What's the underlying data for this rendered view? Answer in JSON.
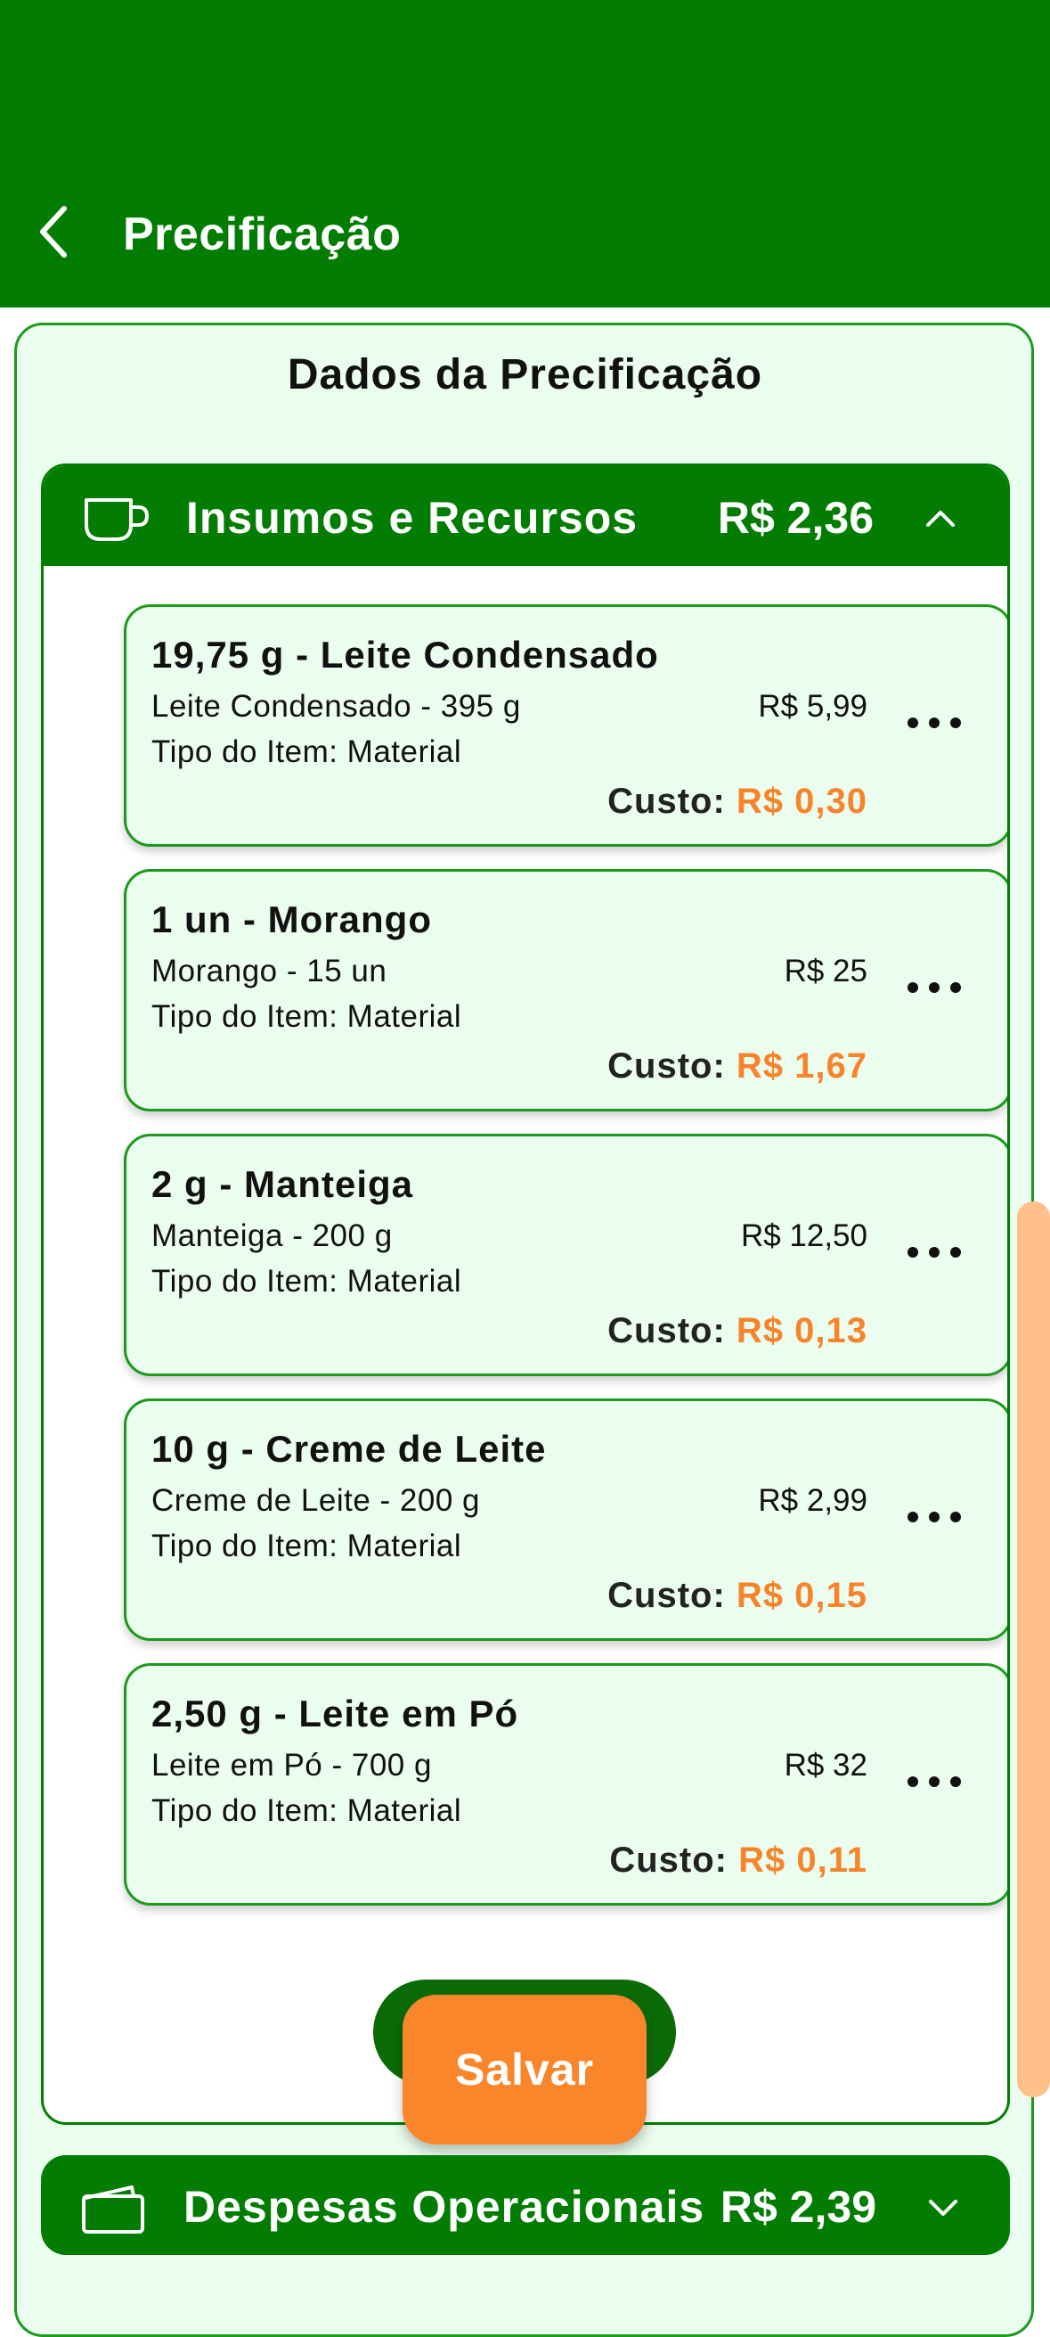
{
  "header": {
    "title": "Precificação",
    "background": "#027d02"
  },
  "panel": {
    "title": "Dados da Precificação"
  },
  "sections": [
    {
      "icon": "cup-icon",
      "title": "Insumos e Recursos",
      "total": "R$ 2,36",
      "expanded": true,
      "items": [
        {
          "title": "19,75 g - Leite Condensado",
          "description": "Leite Condensado - 395 g",
          "price": "R$ 5,99",
          "type": "Tipo do Item: Material",
          "cost_label": "Custo:",
          "cost_value": "R$ 0,30"
        },
        {
          "title": "1 un - Morango",
          "description": "Morango - 15 un",
          "price": "R$ 25",
          "type": "Tipo do Item: Material",
          "cost_label": "Custo:",
          "cost_value": "R$ 1,67"
        },
        {
          "title": "2 g - Manteiga",
          "description": "Manteiga - 200 g",
          "price": "R$ 12,50",
          "type": "Tipo do Item: Material",
          "cost_label": "Custo:",
          "cost_value": "R$ 0,13"
        },
        {
          "title": "10 g - Creme de Leite",
          "description": "Creme de Leite - 200 g",
          "price": "R$ 2,99",
          "type": "Tipo do Item: Material",
          "cost_label": "Custo:",
          "cost_value": "R$ 0,15"
        },
        {
          "title": "2,50 g - Leite em Pó",
          "description": "Leite em Pó - 700 g",
          "price": "R$ 32",
          "type": "Tipo do Item: Material",
          "cost_label": "Custo:",
          "cost_value": "R$ 0,11"
        }
      ]
    },
    {
      "icon": "wallet-icon",
      "title": "Despesas Operacionais",
      "total": "R$ 2,39",
      "expanded": false
    }
  ],
  "actions": {
    "save_label": "Salvar"
  },
  "colors": {
    "primary_green": "#027d02",
    "accent_orange": "#fa862c",
    "card_background": "#ebfdef"
  }
}
